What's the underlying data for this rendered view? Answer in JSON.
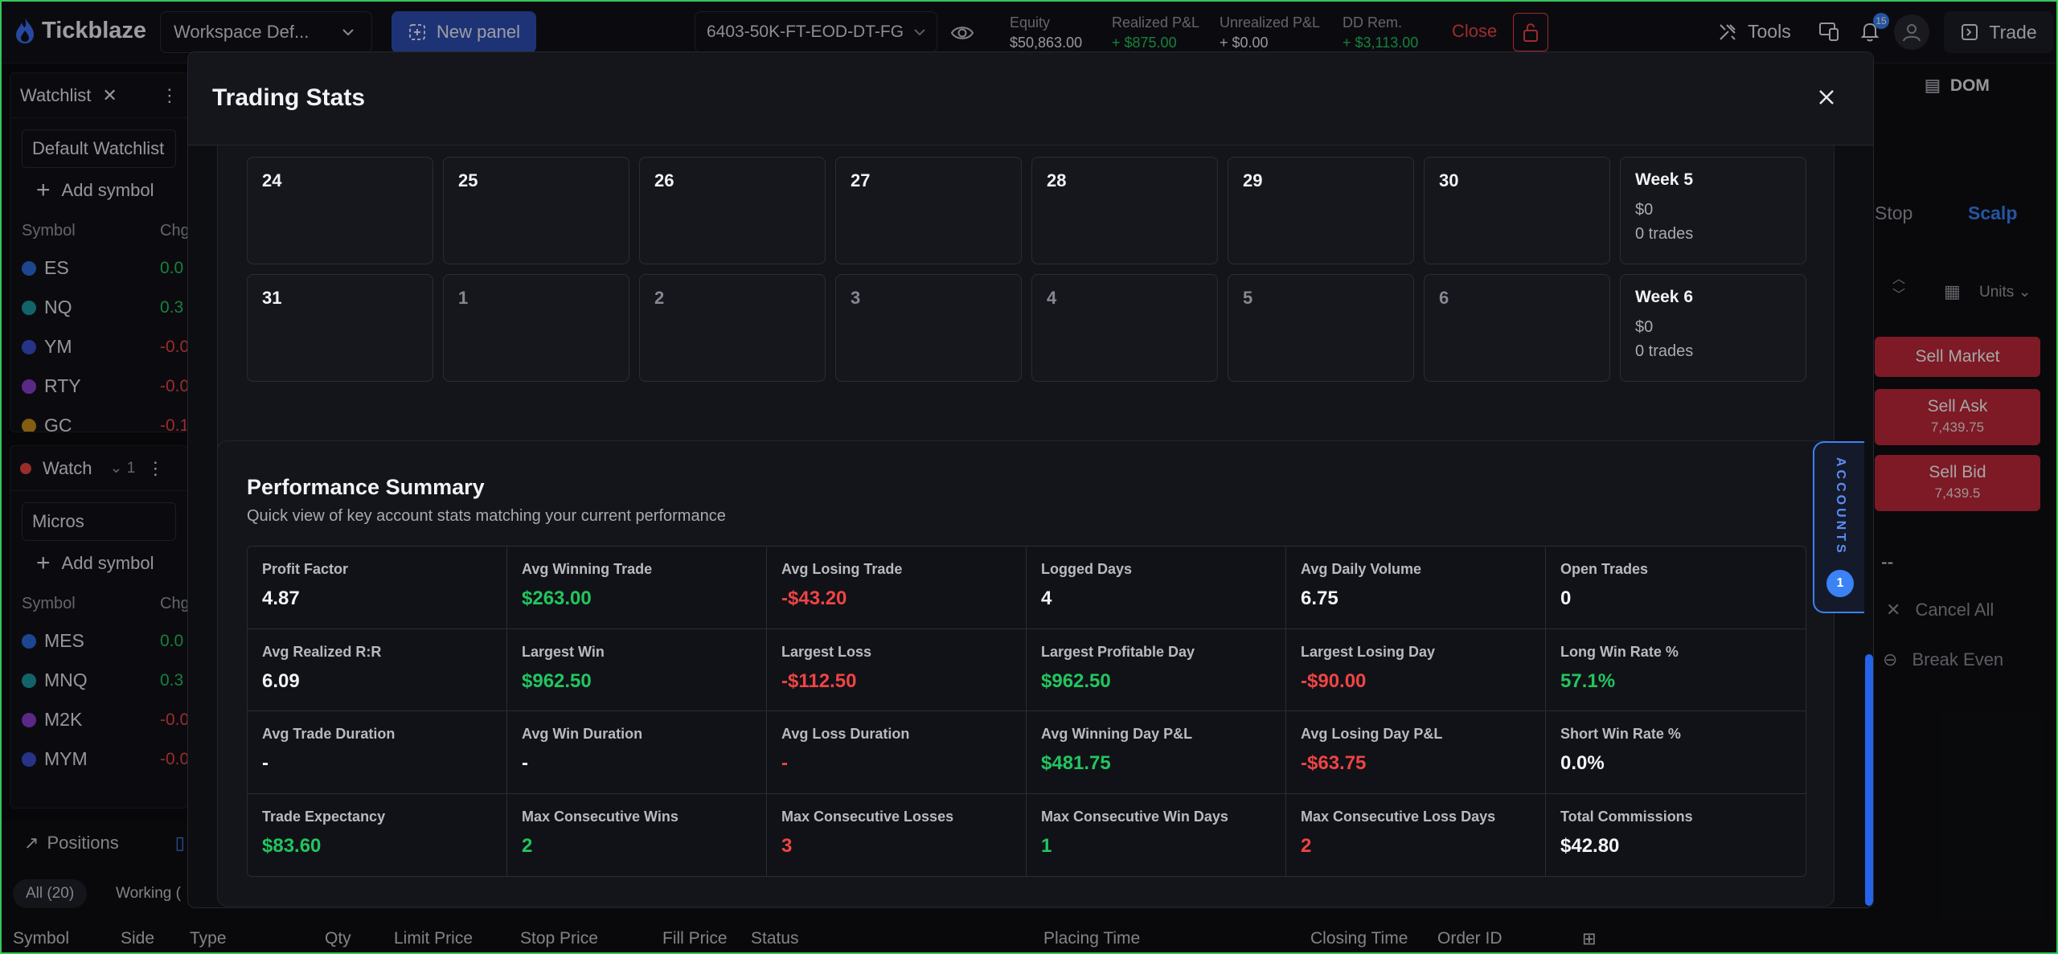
{
  "topbar": {
    "brand": "Tickblaze",
    "workspace": "Workspace Def...",
    "new_panel": "New panel",
    "account": "6403-50K-FT-EOD-DT-FG",
    "stats": [
      {
        "label": "Equity",
        "value": "$50,863.00",
        "color": "neutral"
      },
      {
        "label": "Realized P&L",
        "value": "+ $875.00",
        "color": "green"
      },
      {
        "label": "Unrealized P&L",
        "value": "+ $0.00",
        "color": "neutral"
      },
      {
        "label": "DD Rem.",
        "value": "+ $3,113.00",
        "color": "green"
      }
    ],
    "close": "Close",
    "tools": "Tools",
    "notifications_count": "15",
    "trade": "Trade"
  },
  "watchlist1": {
    "tab": "Watchlist",
    "selected": "Default Watchlist",
    "add_symbol": "Add symbol",
    "col_symbol": "Symbol",
    "col_change": "Chg",
    "rows": [
      {
        "symbol": "ES",
        "chg": "0.0",
        "color": "green",
        "icon": "#2d6cdf"
      },
      {
        "symbol": "NQ",
        "chg": "0.3",
        "color": "green",
        "icon": "#1d9aa5"
      },
      {
        "symbol": "YM",
        "chg": "-0.0",
        "color": "red",
        "icon": "#3b4fd1"
      },
      {
        "symbol": "RTY",
        "chg": "-0.0",
        "color": "red",
        "icon": "#8b3fd1"
      },
      {
        "symbol": "GC",
        "chg": "-0.1",
        "color": "red",
        "icon": "#c9901a"
      }
    ]
  },
  "watchlist2": {
    "tab": "Watch",
    "count": "1",
    "selected": "Micros",
    "add_symbol": "Add symbol",
    "col_symbol": "Symbol",
    "col_change": "Chg",
    "rows": [
      {
        "symbol": "MES",
        "chg": "0.0",
        "color": "green",
        "icon": "#2d6cdf"
      },
      {
        "symbol": "MNQ",
        "chg": "0.3",
        "color": "green",
        "icon": "#1d9aa5"
      },
      {
        "symbol": "M2K",
        "chg": "-0.0",
        "color": "red",
        "icon": "#8b3fd1"
      },
      {
        "symbol": "MYM",
        "chg": "-0.0",
        "color": "red",
        "icon": "#3b4fd1"
      }
    ]
  },
  "positions": {
    "title": "Positions",
    "tab_all": "All (20)",
    "tab_working": "Working (",
    "columns": [
      "Symbol",
      "Side",
      "Type",
      "Qty",
      "Limit Price",
      "Stop Price",
      "Fill Price",
      "Status",
      "Placing Time",
      "Closing Time",
      "Order ID"
    ]
  },
  "dom": {
    "title": "DOM",
    "stop": "Stop",
    "scalp": "Scalp",
    "units": "Units",
    "sell_market": "Sell Market",
    "sell_ask": "Sell Ask",
    "sell_ask_price": "7,439.75",
    "sell_bid": "Sell Bid",
    "sell_bid_price": "7,439.5",
    "dash": "--",
    "cancel_all": "Cancel All",
    "break_even": "Break Even"
  },
  "modal": {
    "title": "Trading Stats",
    "calendar": {
      "week5": {
        "days": [
          "24",
          "25",
          "26",
          "27",
          "28",
          "29",
          "30"
        ],
        "title": "Week 5",
        "amount": "$0",
        "trades": "0 trades"
      },
      "week6": {
        "days": [
          "31",
          "1",
          "2",
          "3",
          "4",
          "5",
          "6"
        ],
        "title": "Week 6",
        "amount": "$0",
        "trades": "0 trades"
      }
    },
    "performance": {
      "title": "Performance Summary",
      "subtitle": "Quick view of key account stats matching your current performance",
      "stats": [
        {
          "label": "Profit Factor",
          "value": "4.87",
          "color": "neutral"
        },
        {
          "label": "Avg Winning Trade",
          "value": "$263.00",
          "color": "green"
        },
        {
          "label": "Avg Losing Trade",
          "value": "-$43.20",
          "color": "red"
        },
        {
          "label": "Logged Days",
          "value": "4",
          "color": "neutral"
        },
        {
          "label": "Avg Daily Volume",
          "value": "6.75",
          "color": "neutral"
        },
        {
          "label": "Open Trades",
          "value": "0",
          "color": "neutral"
        },
        {
          "label": "Avg Realized R:R",
          "value": "6.09",
          "color": "neutral"
        },
        {
          "label": "Largest Win",
          "value": "$962.50",
          "color": "green"
        },
        {
          "label": "Largest Loss",
          "value": "-$112.50",
          "color": "red"
        },
        {
          "label": "Largest Profitable Day",
          "value": "$962.50",
          "color": "green"
        },
        {
          "label": "Largest Losing Day",
          "value": "-$90.00",
          "color": "red"
        },
        {
          "label": "Long Win Rate %",
          "value": "57.1%",
          "color": "green"
        },
        {
          "label": "Avg Trade Duration",
          "value": "-",
          "color": "neutral"
        },
        {
          "label": "Avg Win Duration",
          "value": "-",
          "color": "neutral"
        },
        {
          "label": "Avg Loss Duration",
          "value": "-",
          "color": "red"
        },
        {
          "label": "Avg Winning Day P&L",
          "value": "$481.75",
          "color": "green"
        },
        {
          "label": "Avg Losing Day P&L",
          "value": "-$63.75",
          "color": "red"
        },
        {
          "label": "Short Win Rate %",
          "value": "0.0%",
          "color": "neutral"
        },
        {
          "label": "Trade Expectancy",
          "value": "$83.60",
          "color": "green"
        },
        {
          "label": "Max Consecutive Wins",
          "value": "2",
          "color": "green"
        },
        {
          "label": "Max Consecutive Losses",
          "value": "3",
          "color": "red"
        },
        {
          "label": "Max Consecutive Win Days",
          "value": "1",
          "color": "green"
        },
        {
          "label": "Max Consecutive Loss Days",
          "value": "2",
          "color": "red"
        },
        {
          "label": "Total Commissions",
          "value": "$42.80",
          "color": "neutral"
        }
      ]
    },
    "accounts_tab": {
      "label": "ACCOUNTS",
      "count": "1"
    }
  }
}
